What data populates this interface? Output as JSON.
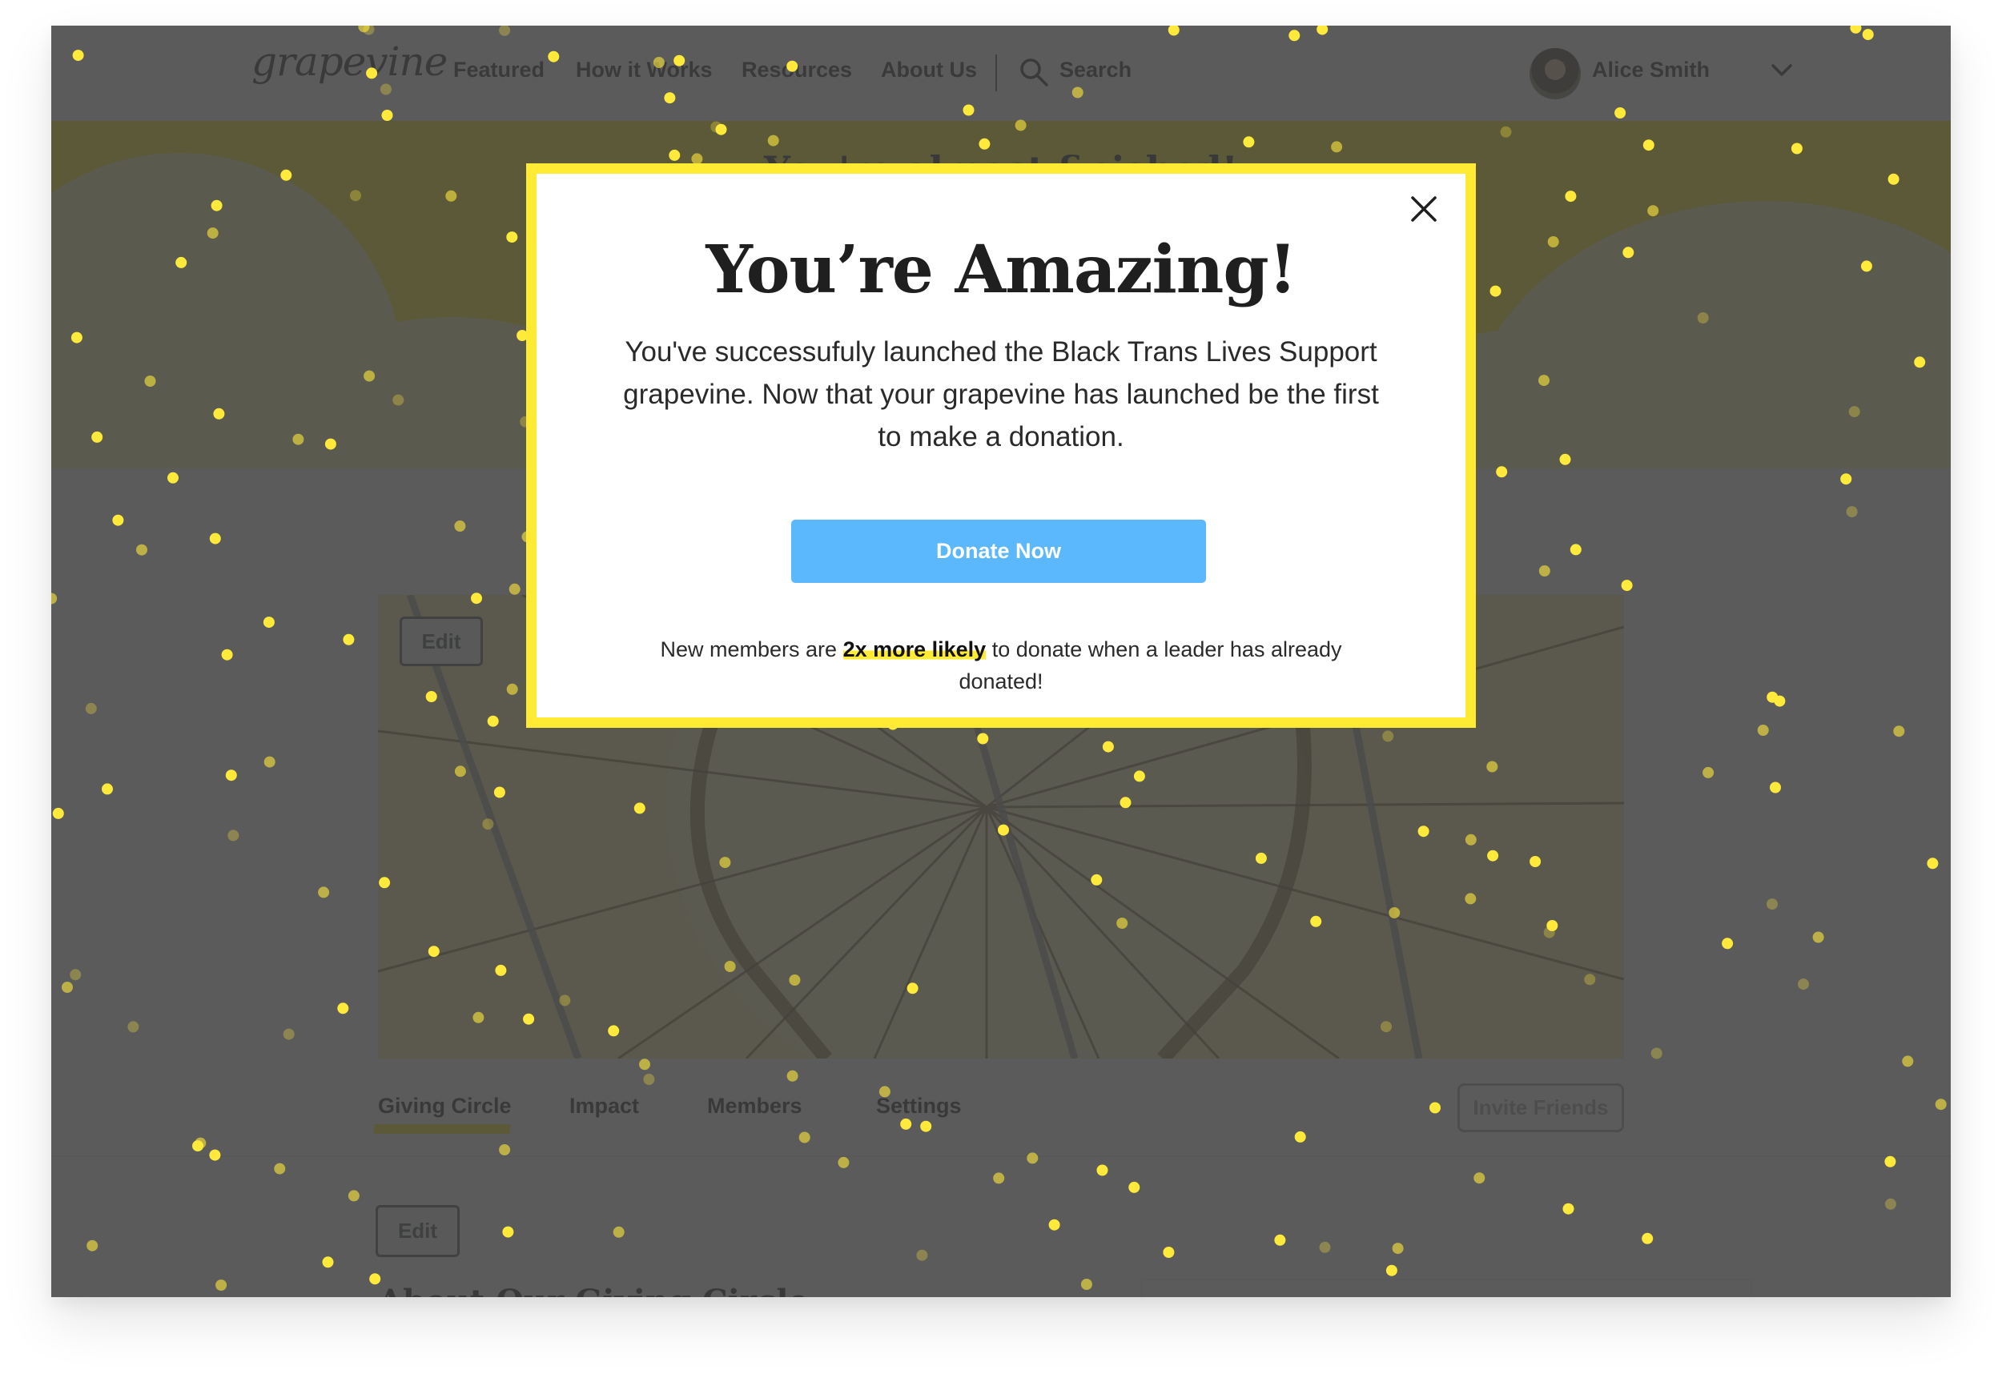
{
  "nav": {
    "logo": "grapevine",
    "items": [
      {
        "label": "Featured"
      },
      {
        "label": "How it Works"
      },
      {
        "label": "Resources"
      },
      {
        "label": "About Us"
      }
    ],
    "search_label": "Search",
    "user_name": "Alice Smith"
  },
  "banner": {
    "title": "You're almost finished!"
  },
  "cover": {
    "edit_label": "Edit"
  },
  "tabs": [
    {
      "label": "Giving Circle",
      "active": true
    },
    {
      "label": "Impact"
    },
    {
      "label": "Members"
    },
    {
      "label": "Settings"
    }
  ],
  "invite_button": "Invite Friends",
  "about": {
    "edit_label": "Edit",
    "heading": "About Our Giving Circle"
  },
  "modal": {
    "title": "You’re Amazing!",
    "body": "You've successufuly launched the Black Trans Lives Support grapevine. Now that your grapevine has launched be the first to make a donation.",
    "cta": "Donate Now",
    "note_before": "New members are ",
    "note_highlight": "2x more likely",
    "note_after": " to donate when a leader has already donated!"
  },
  "colors": {
    "accent_yellow": "#ffeb33",
    "button_blue": "#5cb8fc",
    "overlay": "#404040"
  }
}
